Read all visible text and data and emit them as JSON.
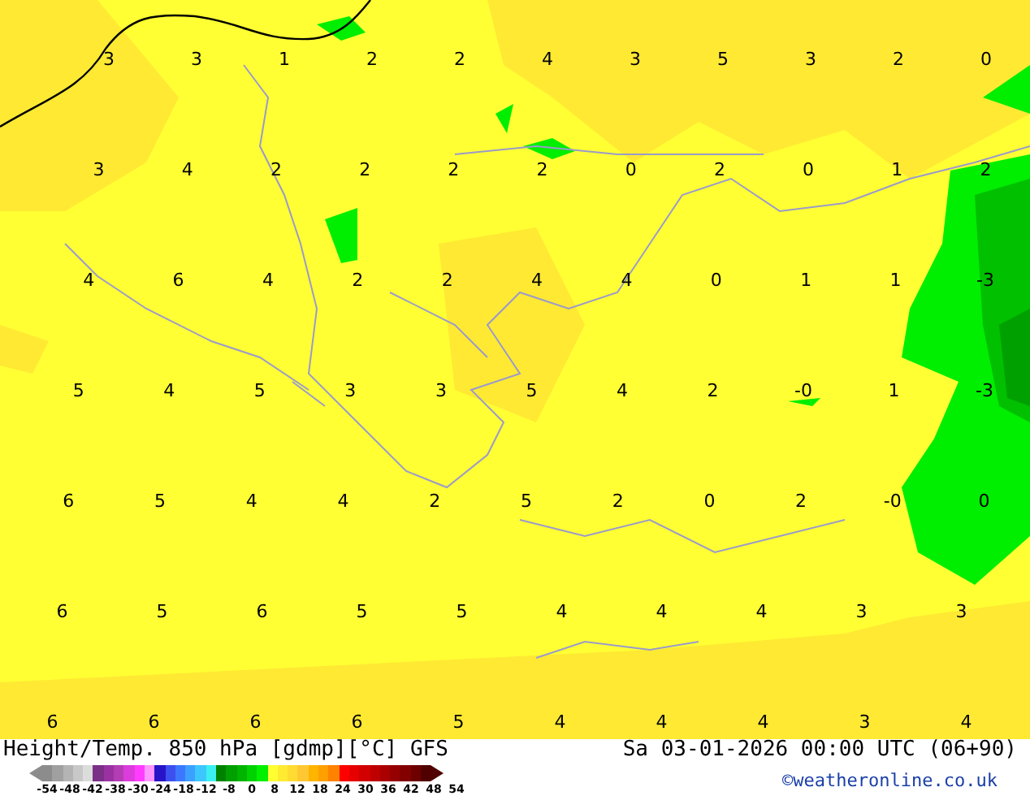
{
  "map": {
    "value_rows": [
      [
        "3",
        "3",
        "1",
        "2",
        "2",
        "4",
        "3",
        "5",
        "3",
        "2",
        "0"
      ],
      [
        "3",
        "4",
        "2",
        "2",
        "2",
        "2",
        "0",
        "2",
        "0",
        "1",
        "2"
      ],
      [
        "4",
        "6",
        "4",
        "2",
        "2",
        "4",
        "4",
        "0",
        "1",
        "1",
        "-3"
      ],
      [
        "5",
        "4",
        "5",
        "3",
        "3",
        "5",
        "4",
        "2",
        "-0",
        "1",
        "-3"
      ],
      [
        "6",
        "5",
        "4",
        "4",
        "2",
        "5",
        "2",
        "0",
        "2",
        "-0",
        "0"
      ],
      [
        "6",
        "5",
        "6",
        "5",
        "5",
        "4",
        "4",
        "4",
        "3",
        "3"
      ],
      [
        "6",
        "6",
        "6",
        "6",
        "5",
        "4",
        "4",
        "4",
        "3",
        "4"
      ]
    ]
  },
  "footer": {
    "title": "Height/Temp. 850 hPa [gdmp][°C] GFS",
    "datetime": "Sa 03-01-2026 00:00 UTC (06+90)",
    "credit": "©weatheronline.co.uk",
    "legend": {
      "swatches": [
        {
          "color": "#8c8c8c"
        },
        {
          "color": "#a0a0a0"
        },
        {
          "color": "#b4b4b4"
        },
        {
          "color": "#c8c8c8"
        },
        {
          "color": "#dcdcdc"
        },
        {
          "color": "#7b2f87"
        },
        {
          "color": "#9932a0"
        },
        {
          "color": "#b43cb4"
        },
        {
          "color": "#dc3cdc"
        },
        {
          "color": "#ff3cff"
        },
        {
          "color": "#ff96ff"
        },
        {
          "color": "#2814c8"
        },
        {
          "color": "#3c50f0"
        },
        {
          "color": "#3c78ff"
        },
        {
          "color": "#3ca0ff"
        },
        {
          "color": "#3cc8ff"
        },
        {
          "color": "#3cf0f0"
        },
        {
          "color": "#008200"
        },
        {
          "color": "#00a000"
        },
        {
          "color": "#00b400"
        },
        {
          "color": "#00d200"
        },
        {
          "color": "#00f000"
        },
        {
          "color": "#ffff32"
        },
        {
          "color": "#ffeb32"
        },
        {
          "color": "#ffdc32"
        },
        {
          "color": "#ffc832"
        },
        {
          "color": "#ffb400"
        },
        {
          "color": "#ffa000"
        },
        {
          "color": "#ff8200"
        },
        {
          "color": "#ff0000"
        },
        {
          "color": "#e60000"
        },
        {
          "color": "#d20000"
        },
        {
          "color": "#be0000"
        },
        {
          "color": "#aa0000"
        },
        {
          "color": "#960000"
        },
        {
          "color": "#820000"
        },
        {
          "color": "#6e0000"
        },
        {
          "color": "#500000"
        }
      ],
      "ticks": [
        "-54",
        "-48",
        "-42",
        "-38",
        "-30",
        "-24",
        "-18",
        "-12",
        "-8",
        "0",
        "8",
        "12",
        "18",
        "24",
        "30",
        "36",
        "42",
        "48",
        "54"
      ]
    }
  }
}
